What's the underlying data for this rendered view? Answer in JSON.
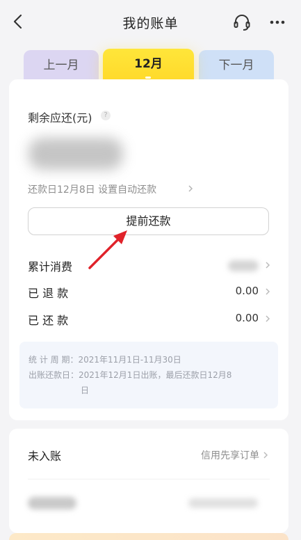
{
  "header": {
    "title": "我的账单"
  },
  "tabs": {
    "prev": "上一月",
    "current": "12月",
    "next": "下一月"
  },
  "summary": {
    "balance_label": "剩余应还(元)",
    "info_glyph": "?",
    "due_text": "还款日12月8日  设置自动还款",
    "prepay_label": "提前还款"
  },
  "rows": [
    {
      "label": "累计消费",
      "value": ""
    },
    {
      "label": "已 退 款",
      "value": "0.00"
    },
    {
      "label": "已 还 款",
      "value": "0.00"
    }
  ],
  "statement": {
    "line1": "统 计 周 期：2021年11月1日-11月30日",
    "line2": "出账还款日：2021年12月1日出账，最后还款日12月8",
    "line3": "日"
  },
  "unposted": {
    "label": "未入账",
    "link": "信用先享订单"
  },
  "colors": {
    "accent_yellow": "#ffd92a",
    "arrow_red": "#e0222a",
    "prev_tab": "#dcd6f2",
    "next_tab": "#cfe0f7"
  },
  "icons": [
    "back-icon",
    "headset-icon",
    "more-icon",
    "info-icon",
    "chevron-right-icon",
    "annotation-arrow-icon"
  ]
}
